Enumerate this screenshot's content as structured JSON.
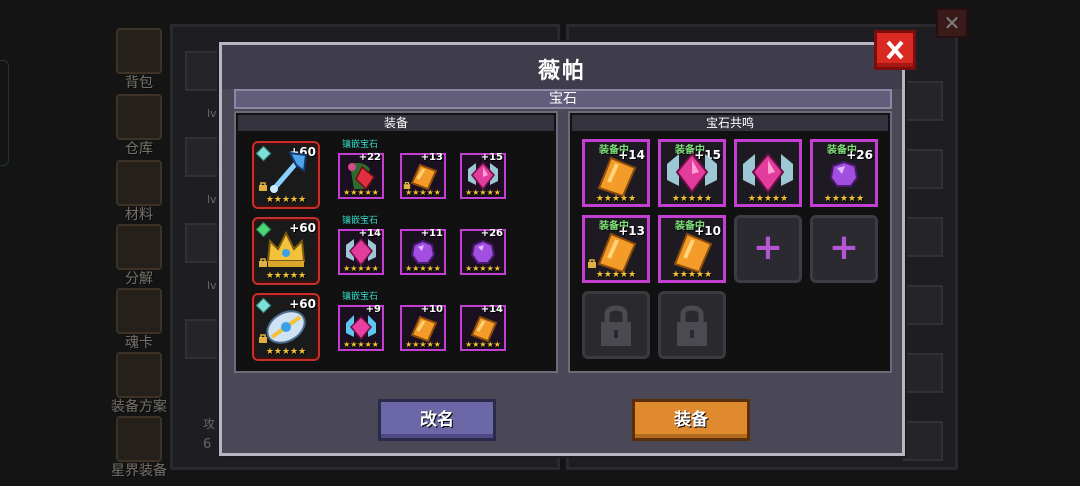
{
  "background": {
    "sidebar": [
      {
        "label": "背包",
        "icon": "backpack-icon"
      },
      {
        "label": "仓库",
        "icon": "chest-icon"
      },
      {
        "label": "材料",
        "icon": "materials-icon"
      },
      {
        "label": "分解",
        "icon": "disassemble-icon"
      },
      {
        "label": "魂卡",
        "icon": "soul-card-icon"
      },
      {
        "label": "装备方案",
        "icon": "equipment-plan-icon"
      },
      {
        "label": "星界装备",
        "icon": "astral-equipment-icon"
      }
    ],
    "partial_text": {
      "level_prefix": "lv",
      "attack_prefix": "攻",
      "attack_value_prefix": "6"
    }
  },
  "modal": {
    "title": "薇帕",
    "tab": "宝石",
    "close_icon": "close-x-icon",
    "equip_section": {
      "header": "装备",
      "inlay_label": "镶嵌宝石",
      "rows": [
        {
          "item": {
            "icon": "ice-axe-icon",
            "plus": "+60",
            "stars": 5,
            "locked": true
          },
          "gems": [
            {
              "icon": "rose-gem-icon",
              "plus": "+22",
              "stars": 5,
              "locked": false
            },
            {
              "icon": "orange-scroll-gem-icon",
              "plus": "+13",
              "stars": 5,
              "locked": true
            },
            {
              "icon": "pink-diamond-gem-icon",
              "plus": "+15",
              "stars": 5,
              "locked": false
            }
          ]
        },
        {
          "item": {
            "icon": "golden-crown-icon",
            "plus": "+60",
            "stars": 5,
            "locked": true
          },
          "gems": [
            {
              "icon": "pink-diamond-gem-icon",
              "plus": "+14",
              "stars": 5,
              "locked": false
            },
            {
              "icon": "purple-orb-gem-icon",
              "plus": "+11",
              "stars": 5,
              "locked": false
            },
            {
              "icon": "purple-orb-gem-icon",
              "plus": "+26",
              "stars": 5,
              "locked": false
            }
          ]
        },
        {
          "item": {
            "icon": "crystal-shield-icon",
            "plus": "+60",
            "stars": 5,
            "locked": true
          },
          "gems": [
            {
              "icon": "blue-pink-gem-icon",
              "plus": "+9",
              "stars": 5,
              "locked": false
            },
            {
              "icon": "orange-scroll-gem-icon",
              "plus": "+10",
              "stars": 5,
              "locked": false
            },
            {
              "icon": "orange-scroll-gem-icon",
              "plus": "+14",
              "stars": 5,
              "locked": false
            }
          ]
        }
      ]
    },
    "resonance_section": {
      "header": "宝石共鸣",
      "equipped_tag": "装备中",
      "slots": [
        {
          "type": "gem",
          "icon": "orange-scroll-gem-icon",
          "plus": "+14",
          "equipped": true,
          "stars": 5,
          "locked": false
        },
        {
          "type": "gem",
          "icon": "pink-diamond-gem-icon",
          "plus": "+15",
          "equipped": true,
          "stars": 5,
          "locked": false
        },
        {
          "type": "gem",
          "icon": "pink-diamond-gem-icon",
          "plus": "",
          "equipped": false,
          "stars": 5,
          "locked": false
        },
        {
          "type": "gem",
          "icon": "purple-orb-gem-icon",
          "plus": "+26",
          "equipped": true,
          "stars": 5,
          "locked": false
        },
        {
          "type": "gem",
          "icon": "orange-scroll-gem-icon",
          "plus": "+13",
          "equipped": true,
          "stars": 5,
          "locked": true
        },
        {
          "type": "gem",
          "icon": "orange-scroll-gem-icon",
          "plus": "+10",
          "equipped": true,
          "stars": 5,
          "locked": false
        },
        {
          "type": "add",
          "icon": "plus-icon"
        },
        {
          "type": "add",
          "icon": "plus-icon"
        },
        {
          "type": "locked",
          "icon": "padlock-icon"
        },
        {
          "type": "locked",
          "icon": "padlock-icon"
        }
      ]
    },
    "buttons": {
      "rename": "改名",
      "equip": "装备"
    },
    "colors": {
      "star": "#f1c232",
      "gem_border": "#c23fd1",
      "equip_border": "#c7302a",
      "rename_btn": "#6c67a6",
      "equip_btn": "#e08a2f",
      "equipped_tag": "#7fe07a",
      "inlay_label": "#35d8c6"
    }
  }
}
